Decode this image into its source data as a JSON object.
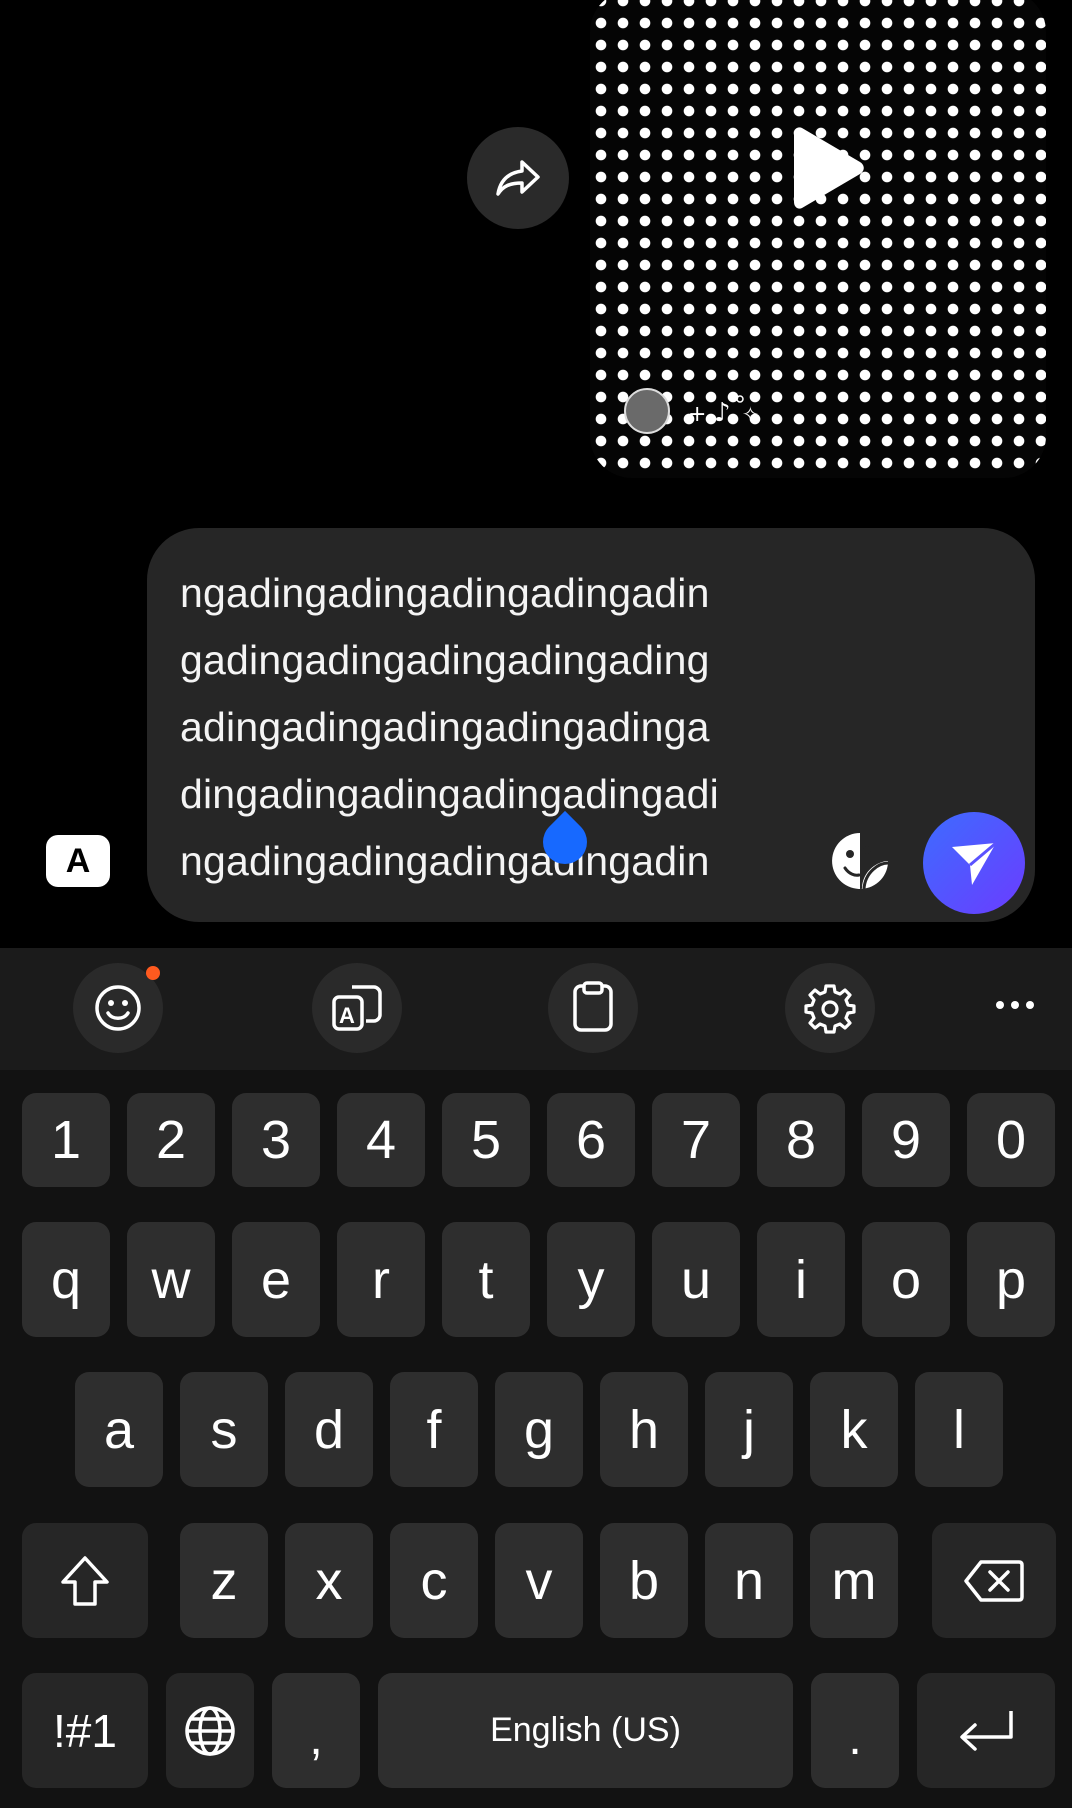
{
  "chat": {
    "message_lines": [
      "ngadingadingadingadingadin",
      "gadingadingadingadingading",
      "adingadingadingadingadinga",
      "dingadingadingadingadingadi",
      "ngadingadingadingadingadin"
    ],
    "keyboard_toggle_label": "A"
  },
  "keyboard": {
    "number_row": [
      "1",
      "2",
      "3",
      "4",
      "5",
      "6",
      "7",
      "8",
      "9",
      "0"
    ],
    "row1": [
      "q",
      "w",
      "e",
      "r",
      "t",
      "y",
      "u",
      "i",
      "o",
      "p"
    ],
    "row2": [
      "a",
      "s",
      "d",
      "f",
      "g",
      "h",
      "j",
      "k",
      "l"
    ],
    "row3": [
      "z",
      "x",
      "c",
      "v",
      "b",
      "n",
      "m"
    ],
    "symbols_label": "!#1",
    "comma_label": ",",
    "space_label": "English (US)",
    "period_label": "."
  },
  "colors": {
    "background": "#000000",
    "composer": "#262626",
    "key": "#2e2e2e",
    "send_gradient_start": "#3d6cff",
    "send_gradient_end": "#6b3cff",
    "notification_dot": "#ff5a1f",
    "cursor_handle": "#1769ff"
  },
  "icons": {
    "share": "share-arrow-icon",
    "play": "play-icon",
    "sticker": "sticker-icon",
    "send": "send-icon",
    "emoji": "emoji-icon",
    "translate": "translate-icon",
    "clipboard": "clipboard-icon",
    "settings": "gear-icon",
    "more": "more-icon",
    "shift": "shift-icon",
    "backspace": "backspace-icon",
    "globe": "globe-icon",
    "enter": "enter-icon"
  }
}
